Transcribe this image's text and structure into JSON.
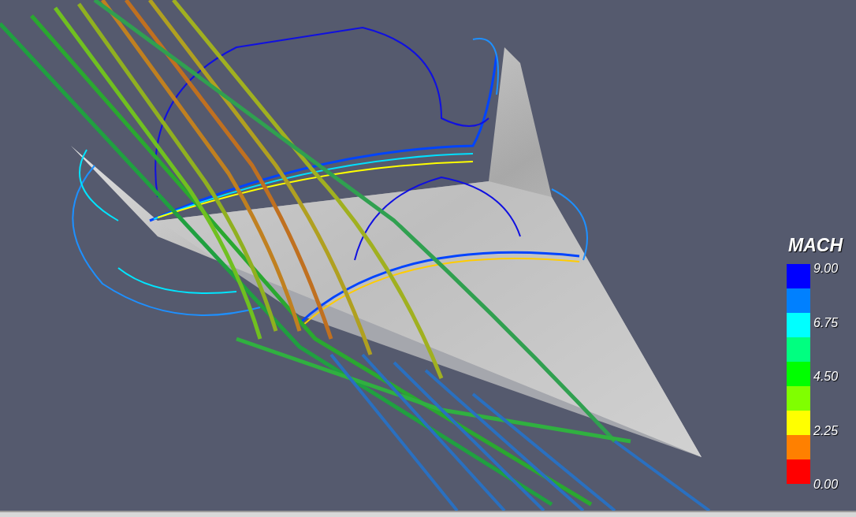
{
  "legend": {
    "title": "MACH",
    "swatches": [
      {
        "color": "#0000ff"
      },
      {
        "color": "#0080ff"
      },
      {
        "color": "#00ffff"
      },
      {
        "color": "#00ff80"
      },
      {
        "color": "#00ff00"
      },
      {
        "color": "#80ff00"
      },
      {
        "color": "#ffff00"
      },
      {
        "color": "#ff8000"
      },
      {
        "color": "#ff0000"
      }
    ],
    "labels": [
      "9.00",
      "6.75",
      "4.50",
      "2.25",
      "0.00"
    ]
  }
}
